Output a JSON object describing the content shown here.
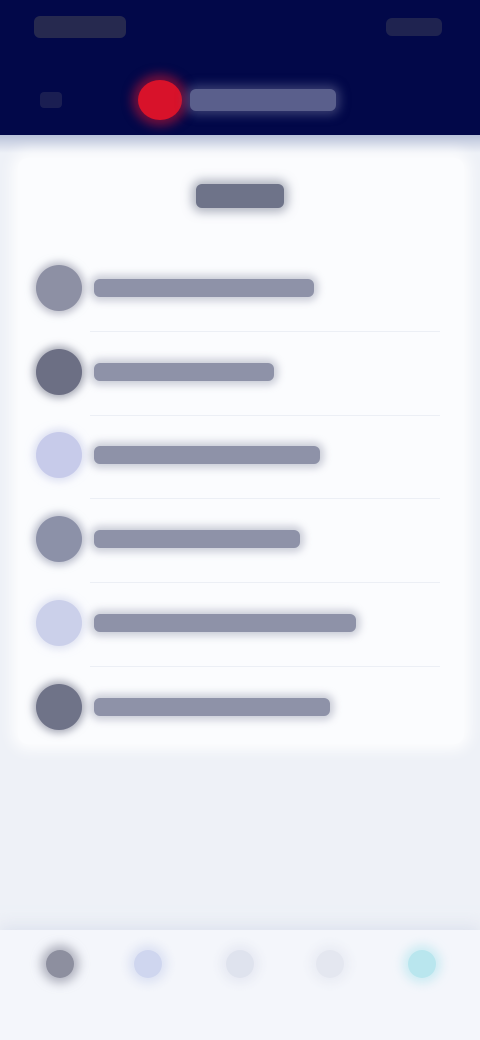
{
  "colors": {
    "header_bg": "#020849",
    "brand_red": "#d8122a",
    "card_bg": "#fbfcfe",
    "page_bg": "#eef1f7",
    "nav_active": "#7fd3e6"
  },
  "menu": {
    "items": [
      {
        "icon": "menu-icon",
        "color": "#8d90a4"
      },
      {
        "icon": "menu-icon",
        "color": "#6c6f84"
      },
      {
        "icon": "menu-icon",
        "color": "#c7cbea"
      },
      {
        "icon": "menu-icon",
        "color": "#8c91a8"
      },
      {
        "icon": "menu-icon",
        "color": "#cbd0ea"
      },
      {
        "icon": "menu-icon",
        "color": "#6f7388"
      }
    ]
  },
  "bottom_nav": {
    "items": [
      {
        "icon": "home-icon",
        "color": "#8d8f9f"
      },
      {
        "icon": "nav-icon",
        "color": "#cfd6ef"
      },
      {
        "icon": "nav-icon",
        "color": "#dfe3ee"
      },
      {
        "icon": "nav-icon",
        "color": "#e4e7f0"
      },
      {
        "icon": "nav-icon",
        "color": "#b9e6ee"
      }
    ]
  }
}
